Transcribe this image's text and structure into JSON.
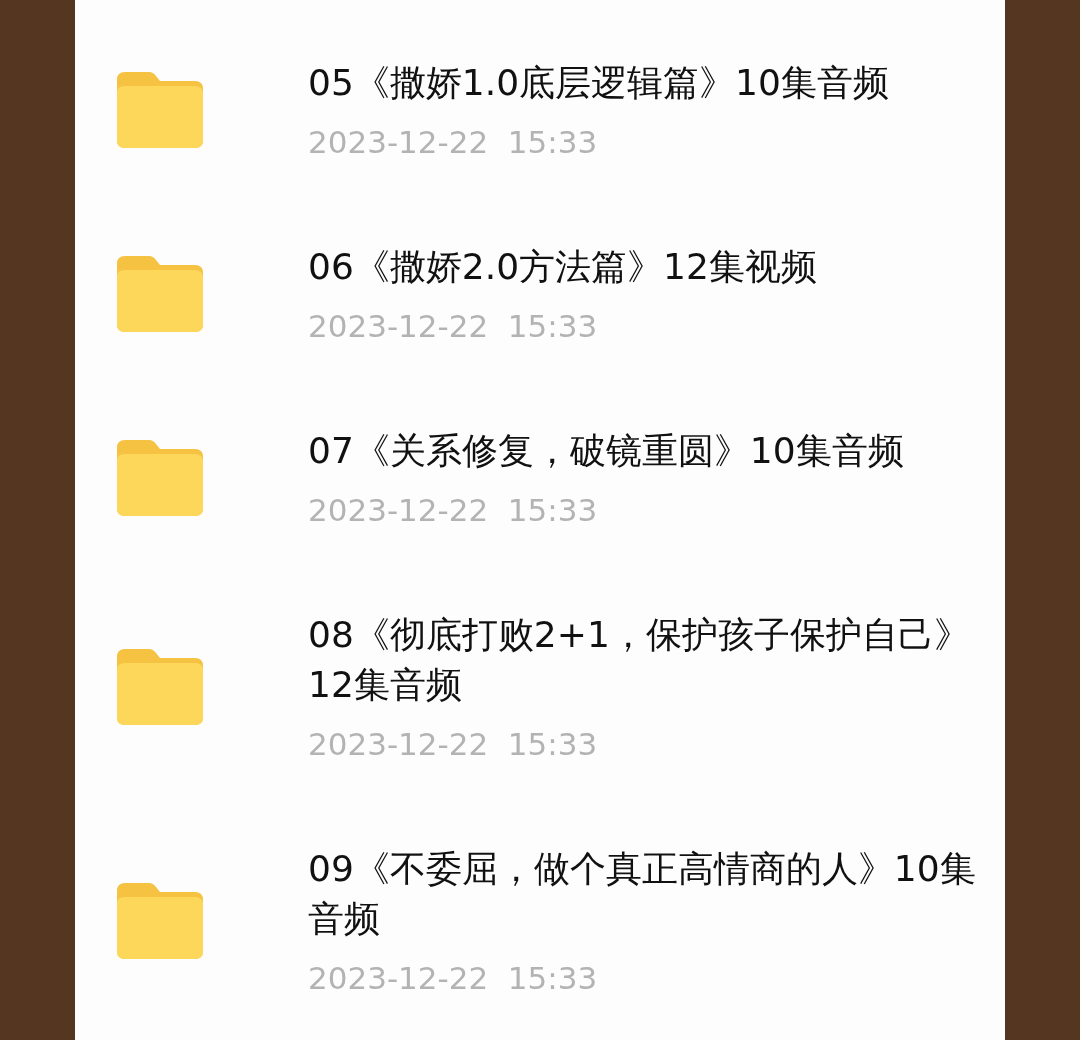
{
  "folders": [
    {
      "title": "05《撒娇1.0底层逻辑篇》10集音频",
      "date": "2023-12-22  15:33"
    },
    {
      "title": "06《撒娇2.0方法篇》12集视频",
      "date": "2023-12-22  15:33"
    },
    {
      "title": "07《关系修复，破镜重圆》10集音频",
      "date": "2023-12-22  15:33"
    },
    {
      "title": "08《彻底打败2+1，保护孩子保护自己》12集音频",
      "date": "2023-12-22  15:33"
    },
    {
      "title": "09《不委屈，做个真正高情商的人》10集音频",
      "date": "2023-12-22  15:33"
    }
  ]
}
